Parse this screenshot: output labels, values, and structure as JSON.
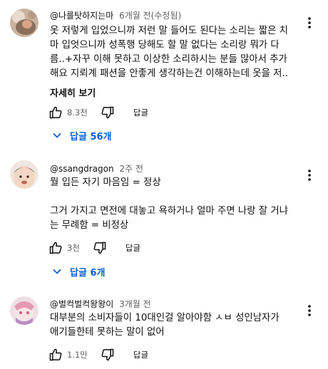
{
  "comments": [
    {
      "author": "@나를탓하지는마",
      "time": "6개월 전(수정됨)",
      "lines": [
        "옷 저렇게 입었으니까 저런 말 들어도 된다는 소리는 짧은 치",
        "마 입엇으니까 성폭행 당해도 할 말 없다는 소리랑 뭐가 다",
        "름..+자꾸 이해 못하고 이상한 소리하시는 분들 많아서 추가",
        "해요 지뢰계 패션을 안좋게 생각하는건 이해하는데 옷을 저.."
      ],
      "more_label": "자세히 보기",
      "likes": "8.3천",
      "reply_label": "답글",
      "replies_label": "답글 56개"
    },
    {
      "author": "@ssangdragon",
      "time": "2주 전",
      "lines": [
        "뭘 입든 자기 마음임 = 정상",
        "그거 가지고 면전에 대놓고 욕하거나 얼마 주면 나랑 잘 거냐",
        "는 무례함 = 비정상"
      ],
      "likes": "3천",
      "reply_label": "답글",
      "replies_label": "답글 6개"
    },
    {
      "author": "@벌컥벌컥왕왕이",
      "time": "3개월 전",
      "lines": [
        "대부분의 소비자들이 10대인걸 알아야함  ㅅㅂ 성인남자가",
        "애기들한테 못하는 말이 없어"
      ],
      "likes": "1.1만",
      "reply_label": "답글"
    }
  ],
  "colors": {
    "link_blue": "#065fd4",
    "secondary_text": "#606060"
  },
  "icons": [
    "like-icon",
    "dislike-icon",
    "more-vert-icon",
    "chevron-down-icon"
  ]
}
